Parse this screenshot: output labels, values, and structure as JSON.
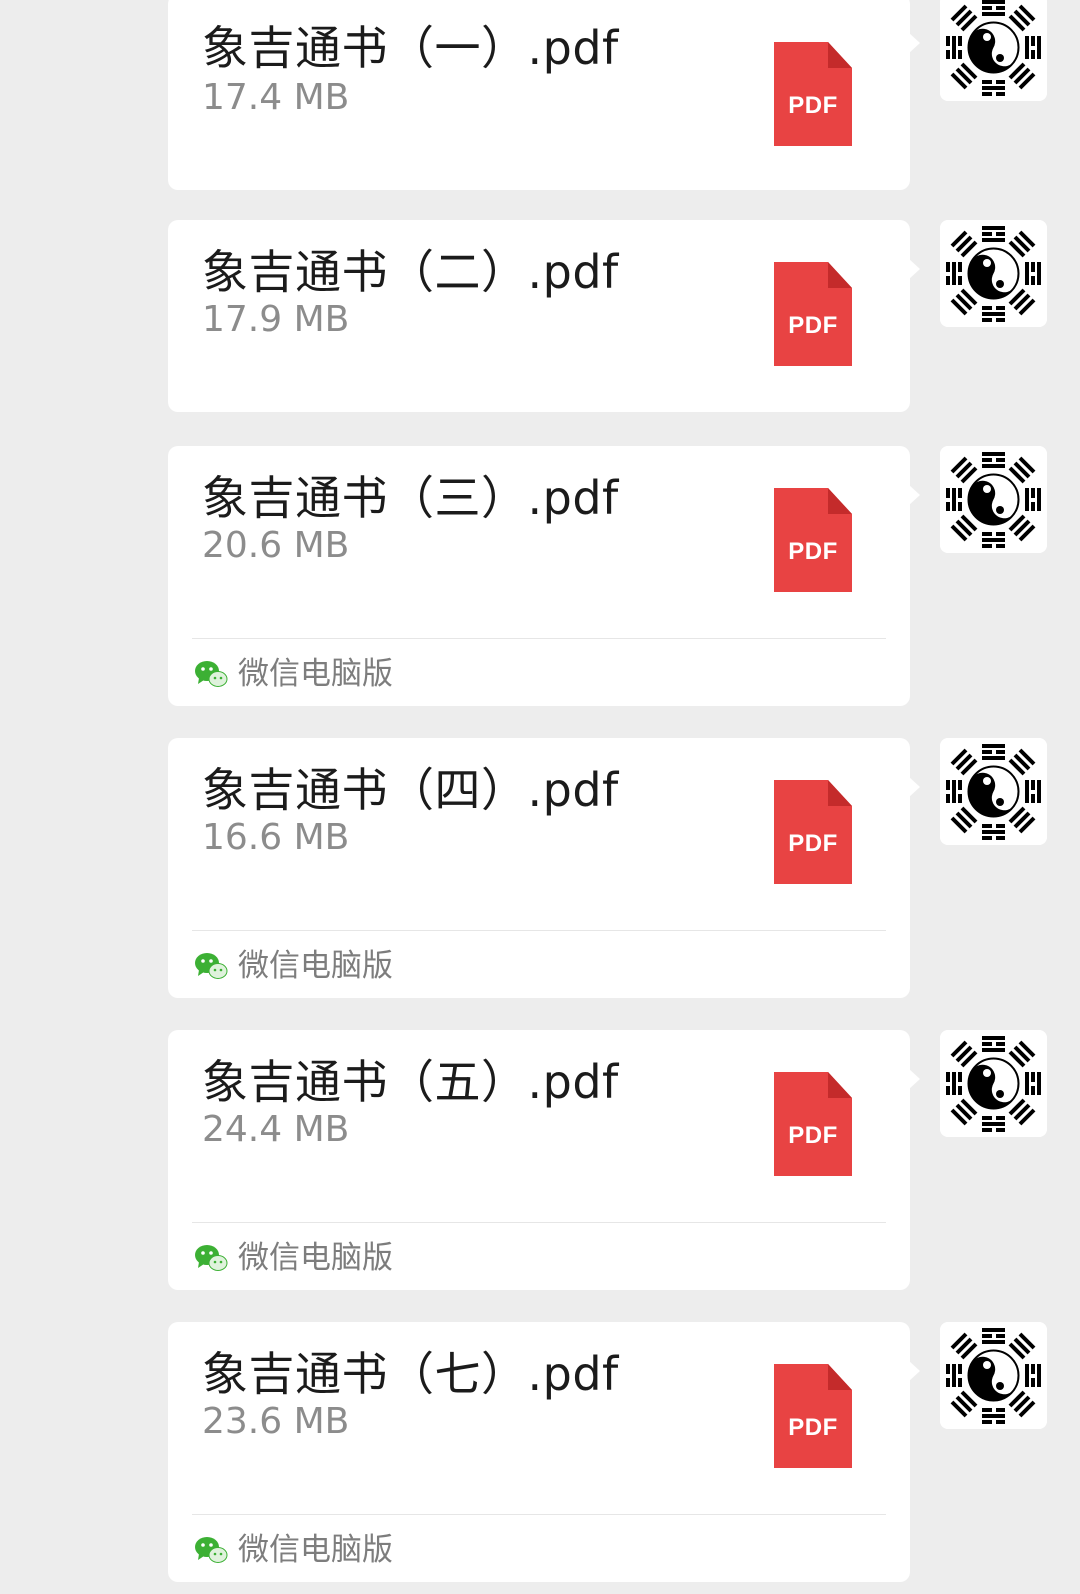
{
  "messages": [
    {
      "name": "象吉通书（一）.pdf",
      "size": "17.4 MB",
      "source": null
    },
    {
      "name": "象吉通书（二）.pdf",
      "size": "17.9 MB",
      "source": null
    },
    {
      "name": "象吉通书（三）.pdf",
      "size": "20.6 MB",
      "source": "微信电脑版"
    },
    {
      "name": "象吉通书（四）.pdf",
      "size": "16.6 MB",
      "source": "微信电脑版"
    },
    {
      "name": "象吉通书（五）.pdf",
      "size": "24.4 MB",
      "source": "微信电脑版"
    },
    {
      "name": "象吉通书（七）.pdf",
      "size": "23.6 MB",
      "source": "微信电脑版"
    }
  ],
  "pdf_icon_label": "PDF",
  "colors": {
    "background": "#ededed",
    "card": "#ffffff",
    "pdf_red": "#e84343",
    "pdf_fold": "#c42b2b",
    "wechat_green": "#3cb034",
    "size_text": "#8c8c8c"
  },
  "icons": {
    "file_type": "pdf-file-icon",
    "source_app": "wechat-icon",
    "avatar": "yin-yang-bagua-avatar"
  }
}
